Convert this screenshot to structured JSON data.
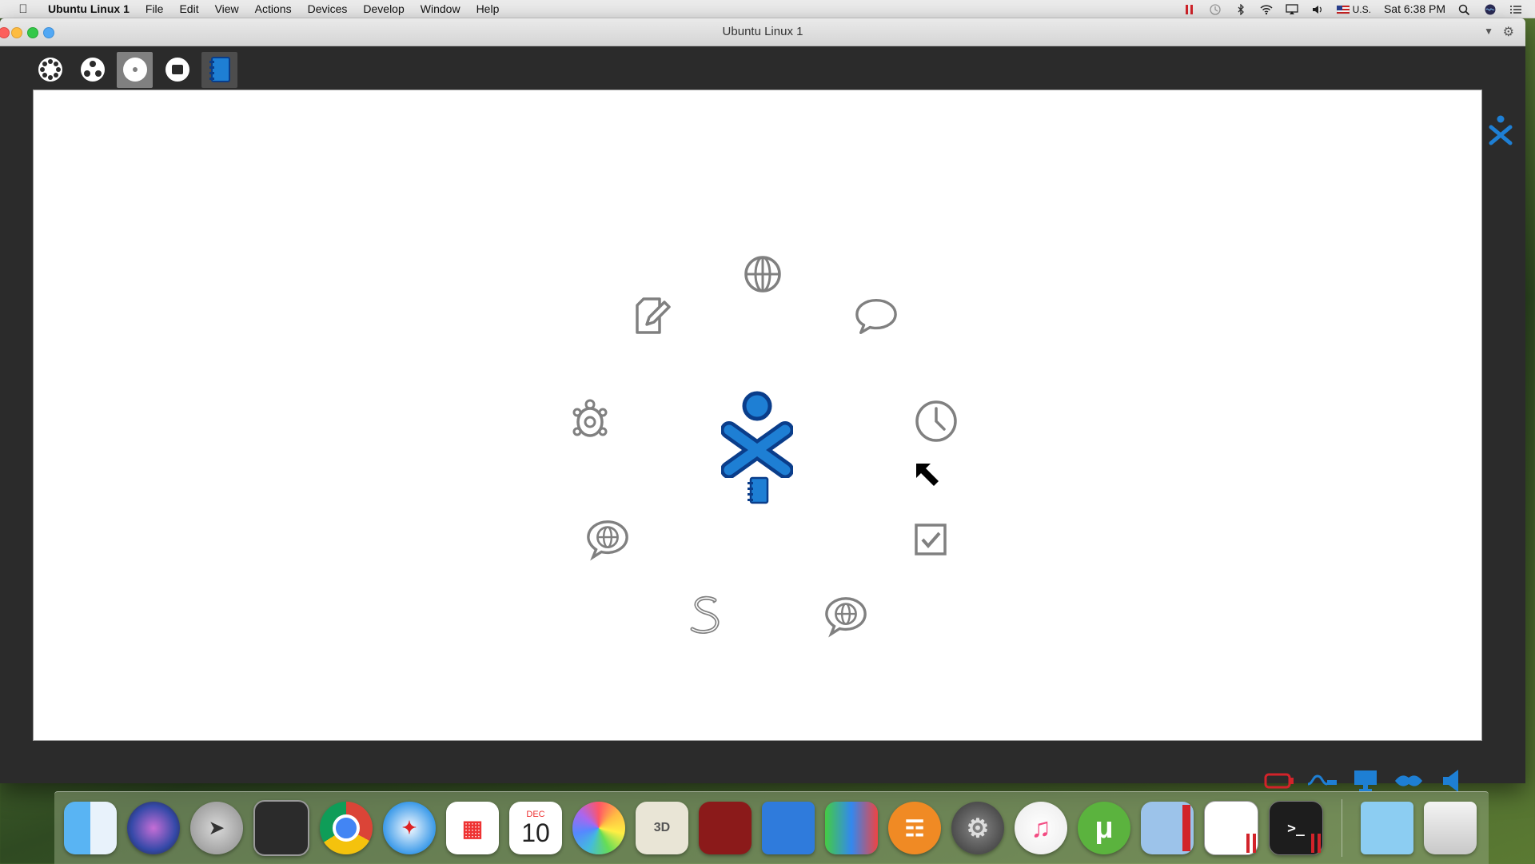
{
  "menubar": {
    "app_name": "Ubuntu Linux 1",
    "items": [
      "File",
      "Edit",
      "View",
      "Actions",
      "Devices",
      "Develop",
      "Window",
      "Help"
    ],
    "input_source": "U.S.",
    "clock": "Sat 6:38 PM"
  },
  "window": {
    "title": "Ubuntu Linux 1"
  },
  "sugar_toolbar": {
    "buttons": [
      "neighborhood-view",
      "group-view",
      "home-view",
      "activity-view",
      "journal"
    ]
  },
  "home_activities": [
    "browse",
    "write",
    "chat",
    "turtle-art",
    "clock",
    "speak-globe",
    "checkbox",
    "pippy-snake",
    "chat-globe"
  ],
  "dock": {
    "calendar_month": "DEC",
    "calendar_day": "10"
  },
  "colors": {
    "xo_blue": "#1e7fd4",
    "xo_blue_dark": "#0a3d8a",
    "sugar_gray": "#808080"
  }
}
